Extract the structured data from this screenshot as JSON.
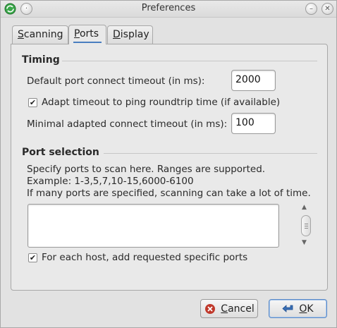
{
  "window": {
    "title": "Preferences",
    "minimize_glyph": "–",
    "close_glyph": "✕"
  },
  "tabs": [
    {
      "label_mnemonic": "S",
      "label_rest": "canning",
      "active": false
    },
    {
      "label_mnemonic": "P",
      "label_rest": "orts",
      "active": true
    },
    {
      "label_mnemonic": "D",
      "label_rest": "isplay",
      "active": false
    }
  ],
  "timing": {
    "group_title": "Timing",
    "connect_timeout_label": "Default port connect timeout (in ms):",
    "connect_timeout_value": "2000",
    "adapt_checkbox_label": "Adapt timeout to ping roundtrip time (if available)",
    "adapt_checked": true,
    "min_adapted_label": "Minimal adapted connect timeout (in ms):",
    "min_adapted_value": "100"
  },
  "port_selection": {
    "group_title": "Port selection",
    "help_line1": "Specify ports to scan here. Ranges are supported.",
    "help_line2": "Example: 1-3,5,7,10-15,6000-6100",
    "help_line3": "If many ports are specified, scanning can take a lot of time.",
    "ports_value": "",
    "add_specific_label": "For each host, add requested specific ports",
    "add_specific_checked": true
  },
  "buttons": {
    "cancel_mnemonic": "C",
    "cancel_rest": "ancel",
    "ok_mnemonic": "O",
    "ok_rest": "K"
  },
  "colors": {
    "accent": "#4a7fc0",
    "cancel_icon": "#c0392b",
    "ok_icon": "#3a6fb5"
  }
}
